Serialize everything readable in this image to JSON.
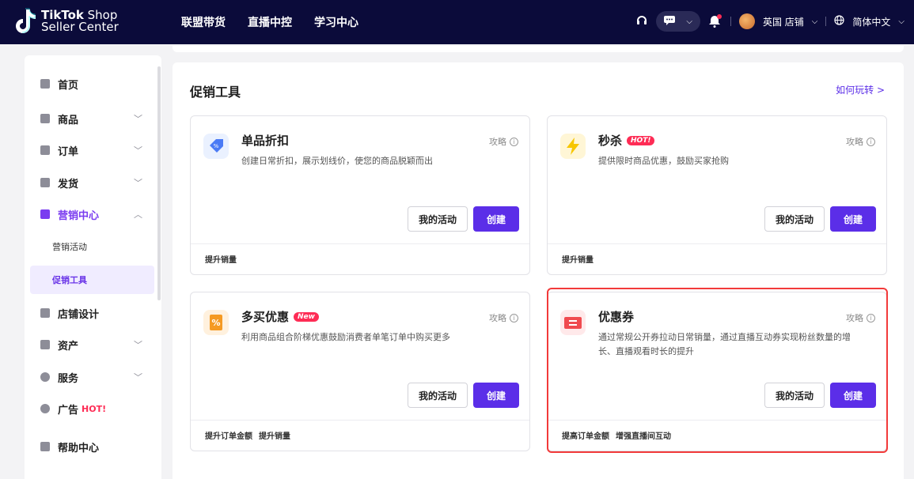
{
  "header": {
    "logo_line1_bold": "TikTok",
    "logo_line1_rest": " Shop",
    "logo_line2": "Seller Center",
    "nav": [
      "联盟带货",
      "直播中控",
      "学习中心"
    ],
    "store_name": "英国 店铺",
    "language": "简体中文",
    "icons": [
      "headset-icon",
      "message-icon",
      "bell-icon",
      "globe-icon"
    ]
  },
  "sidebar": {
    "items": [
      {
        "label": "首页",
        "icon": "home-icon"
      },
      {
        "label": "商品",
        "icon": "product-icon"
      },
      {
        "label": "订单",
        "icon": "order-icon"
      },
      {
        "label": "发货",
        "icon": "shipping-icon"
      },
      {
        "label": "营销中心",
        "icon": "marketing-icon"
      },
      {
        "label": "店铺设计",
        "icon": "store-design-icon"
      },
      {
        "label": "资产",
        "icon": "wallet-icon"
      },
      {
        "label": "服务",
        "icon": "service-icon"
      },
      {
        "label": "广告",
        "icon": "ads-icon"
      },
      {
        "label": "帮助中心",
        "icon": "help-icon"
      }
    ],
    "sub_items": [
      "营销活动",
      "促销工具"
    ],
    "hot_label": "HOT!"
  },
  "main": {
    "title": "促销工具",
    "how_link": "如何玩转 >",
    "guide_label": "攻略",
    "my_activity_label": "我的活动",
    "create_label": "创建",
    "cards": [
      {
        "title": "单品折扣",
        "badge": "",
        "desc": "创建日常折扣，展示划线价，使您的商品脱颖而出",
        "tags": [
          "提升销量"
        ]
      },
      {
        "title": "秒杀",
        "badge": "HOT!",
        "desc": "提供限时商品优惠，鼓励买家抢购",
        "tags": [
          "提升销量"
        ]
      },
      {
        "title": "多买优惠",
        "badge": "New",
        "desc": "利用商品组合阶梯优惠鼓励消费者单笔订单中购买更多",
        "tags": [
          "提升订单金额",
          "提升销量"
        ]
      },
      {
        "title": "优惠券",
        "badge": "",
        "desc": "通过常规公开券拉动日常销量，通过直播互动券实现粉丝数量的增长、直播观看时长的提升",
        "tags": [
          "提高订单金额",
          "增强直播间互动"
        ]
      }
    ]
  },
  "colors": {
    "topbar": "#0b0b3a",
    "accent": "#5b2ee8",
    "hot": "#fe2c55",
    "highlight": "#f23a3a"
  }
}
